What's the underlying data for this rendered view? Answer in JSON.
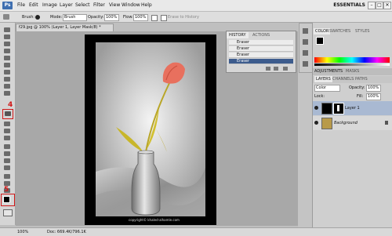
{
  "app": {
    "logo": "Ps",
    "menu": [
      "File",
      "Edit",
      "Image",
      "Layer",
      "Select",
      "Filter",
      "View",
      "Window",
      "Help"
    ],
    "workspace": "ESSENTIALS",
    "window_controls": [
      "–",
      "□",
      "✕"
    ]
  },
  "options_bar": {
    "brush_label": "Brush:",
    "mode_label": "Mode:",
    "mode_value": "Brush",
    "opacity_label": "Opacity:",
    "opacity_value": "100%",
    "flow_label": "Flow:",
    "flow_value": "100%",
    "erase_history_label": "Erase to History"
  },
  "document": {
    "tab_title": "f29.jpg @ 100% (Layer 1, Layer Mask/8) *",
    "copyright": "copyright© khaled-alhamle.com",
    "colors": {
      "flower": "#e8705e",
      "stem": "#c8b62a"
    }
  },
  "history_panel": {
    "tabs": [
      "HISTORY",
      "ACTIONS"
    ],
    "states": [
      "Eraser",
      "Eraser",
      "Eraser",
      "Eraser"
    ]
  },
  "color_panel": {
    "tabs": [
      "COLOR",
      "SWATCHES",
      "STYLES"
    ],
    "adjust_tabs": [
      "ADJUSTMENTS",
      "MASKS"
    ]
  },
  "layers_panel": {
    "tabs": [
      "LAYERS",
      "CHANNELS",
      "PATHS"
    ],
    "blend_mode": "Color",
    "opacity_label": "Opacity:",
    "opacity_value": "100%",
    "lock_label": "Lock:",
    "fill_label": "Fill:",
    "fill_value": "100%",
    "layers": [
      {
        "name": "Layer 1"
      },
      {
        "name": "Background"
      }
    ]
  },
  "annotations": {
    "eraser_number": "4",
    "color_number": "5"
  },
  "status": {
    "zoom": "100%",
    "doc": "Doc: 669.4K/796.1K"
  }
}
